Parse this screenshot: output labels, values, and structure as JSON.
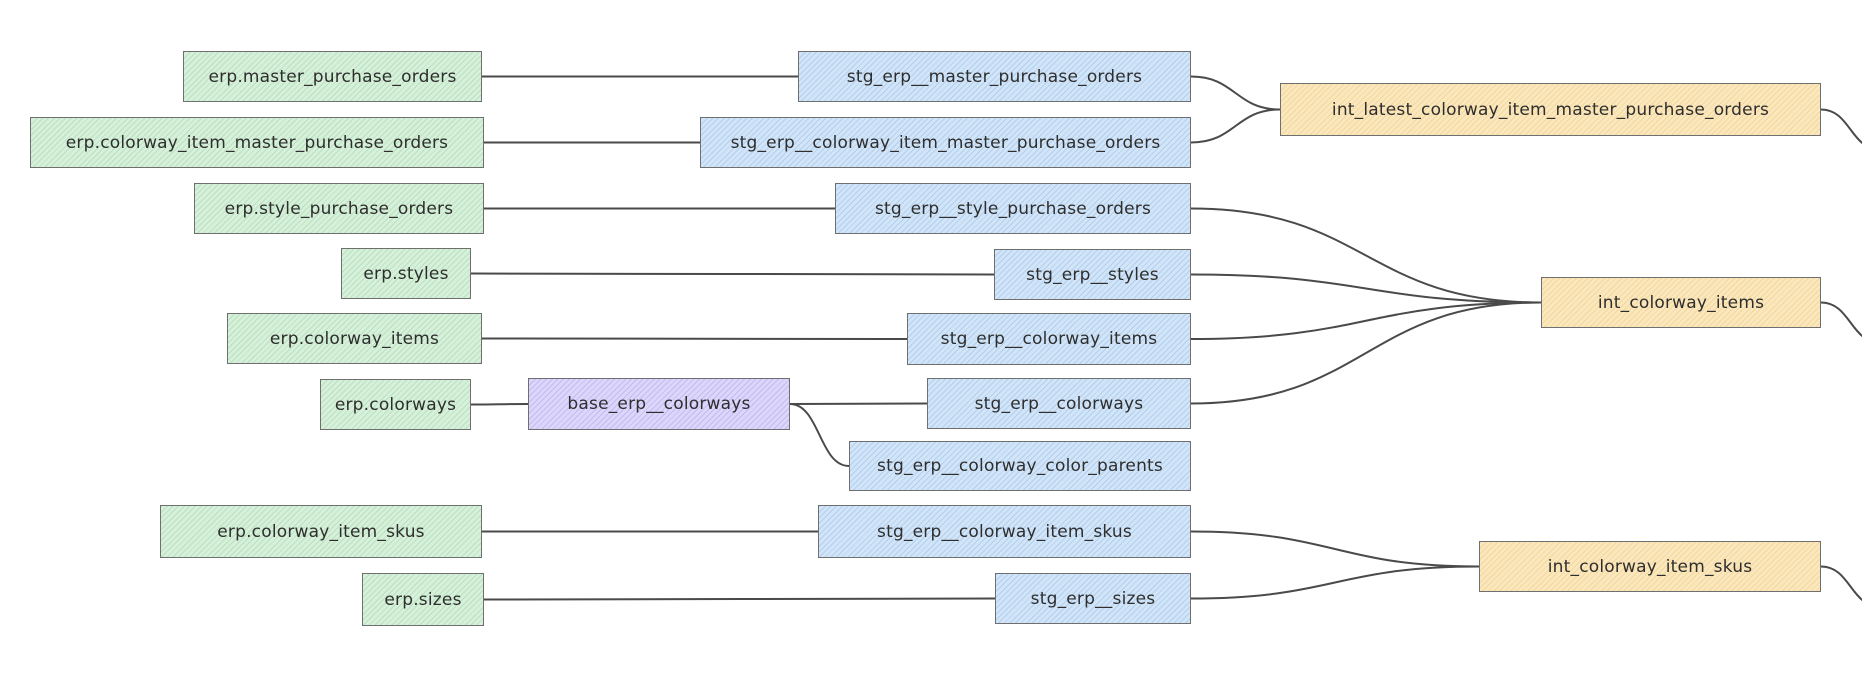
{
  "diagram": {
    "type": "lineage-graph",
    "colors": {
      "source": "#d6f0da",
      "staging": "#d2e5f8",
      "base": "#dcd6fa",
      "intermediate": "#fbe7bd",
      "edge": "#4a4a4a",
      "border": "#6f6f6f"
    },
    "nodes": [
      {
        "id": "src_mpo",
        "label": "erp.master_purchase_orders",
        "kind": "source"
      },
      {
        "id": "src_cimpo",
        "label": "erp.colorway_item_master_purchase_orders",
        "kind": "source"
      },
      {
        "id": "src_spo",
        "label": "erp.style_purchase_orders",
        "kind": "source"
      },
      {
        "id": "src_styles",
        "label": "erp.styles",
        "kind": "source"
      },
      {
        "id": "src_ci",
        "label": "erp.colorway_items",
        "kind": "source"
      },
      {
        "id": "src_cw",
        "label": "erp.colorways",
        "kind": "source"
      },
      {
        "id": "src_cis",
        "label": "erp.colorway_item_skus",
        "kind": "source"
      },
      {
        "id": "src_sizes",
        "label": "erp.sizes",
        "kind": "source"
      },
      {
        "id": "base_cw",
        "label": "base_erp__colorways",
        "kind": "base"
      },
      {
        "id": "stg_mpo",
        "label": "stg_erp__master_purchase_orders",
        "kind": "staging"
      },
      {
        "id": "stg_cimpo",
        "label": "stg_erp__colorway_item_master_purchase_orders",
        "kind": "staging"
      },
      {
        "id": "stg_spo",
        "label": "stg_erp__style_purchase_orders",
        "kind": "staging"
      },
      {
        "id": "stg_styles",
        "label": "stg_erp__styles",
        "kind": "staging"
      },
      {
        "id": "stg_ci",
        "label": "stg_erp__colorway_items",
        "kind": "staging"
      },
      {
        "id": "stg_cw",
        "label": "stg_erp__colorways",
        "kind": "staging"
      },
      {
        "id": "stg_ccp",
        "label": "stg_erp__colorway_color_parents",
        "kind": "staging"
      },
      {
        "id": "stg_cis",
        "label": "stg_erp__colorway_item_skus",
        "kind": "staging"
      },
      {
        "id": "stg_sizes",
        "label": "stg_erp__sizes",
        "kind": "staging"
      },
      {
        "id": "int_lcimpo",
        "label": "int_latest_colorway_item_master_purchase_orders",
        "kind": "intermediate"
      },
      {
        "id": "int_ci",
        "label": "int_colorway_items",
        "kind": "intermediate"
      },
      {
        "id": "int_cis",
        "label": "int_colorway_item_skus",
        "kind": "intermediate"
      }
    ],
    "edges": [
      [
        "src_mpo",
        "stg_mpo"
      ],
      [
        "src_cimpo",
        "stg_cimpo"
      ],
      [
        "src_spo",
        "stg_spo"
      ],
      [
        "src_styles",
        "stg_styles"
      ],
      [
        "src_ci",
        "stg_ci"
      ],
      [
        "src_cw",
        "base_cw"
      ],
      [
        "base_cw",
        "stg_cw"
      ],
      [
        "base_cw",
        "stg_ccp"
      ],
      [
        "src_cis",
        "stg_cis"
      ],
      [
        "src_sizes",
        "stg_sizes"
      ],
      [
        "stg_mpo",
        "int_lcimpo"
      ],
      [
        "stg_cimpo",
        "int_lcimpo"
      ],
      [
        "stg_spo",
        "int_ci"
      ],
      [
        "stg_styles",
        "int_ci"
      ],
      [
        "stg_ci",
        "int_ci"
      ],
      [
        "stg_cw",
        "int_ci"
      ],
      [
        "stg_cis",
        "int_cis"
      ],
      [
        "stg_sizes",
        "int_cis"
      ],
      [
        "int_lcimpo",
        "offscreen"
      ],
      [
        "int_ci",
        "offscreen"
      ],
      [
        "int_cis",
        "offscreen"
      ]
    ]
  }
}
